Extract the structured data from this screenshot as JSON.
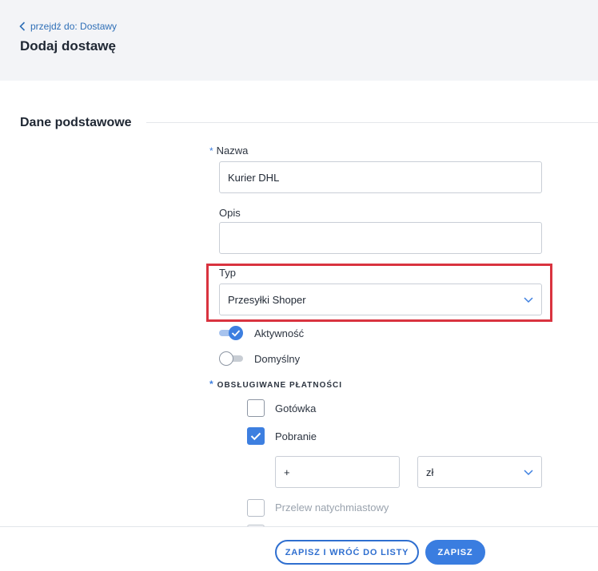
{
  "header": {
    "back_link": "przejdź do: Dostawy",
    "title": "Dodaj dostawę"
  },
  "section": {
    "title": "Dane podstawowe"
  },
  "form": {
    "name": {
      "label": "Nazwa",
      "required_mark": "*",
      "value": "Kurier DHL"
    },
    "description": {
      "label": "Opis",
      "value": ""
    },
    "type": {
      "label": "Typ",
      "selected": "Przesyłki Shoper"
    },
    "active": {
      "label": "Aktywność",
      "on": true
    },
    "default": {
      "label": "Domyślny",
      "on": false
    },
    "payments": {
      "label": "OBSŁUGIWANE PŁATNOŚCI",
      "required_mark": "*",
      "items": [
        {
          "label": "Gotówka",
          "checked": false,
          "disabled": false
        },
        {
          "label": "Pobranie",
          "checked": true,
          "disabled": false
        },
        {
          "label": "Przelew natychmiastowy",
          "checked": false,
          "disabled": true
        }
      ],
      "surcharge": {
        "value": "+",
        "currency": "zł"
      }
    }
  },
  "footer": {
    "save_and_back": "ZAPISZ I WRÓĆ DO LISTY",
    "save": "ZAPISZ"
  },
  "colors": {
    "accent": "#3d7fe0",
    "highlight": "#d9333f",
    "header_bg": "#f3f4f7"
  }
}
